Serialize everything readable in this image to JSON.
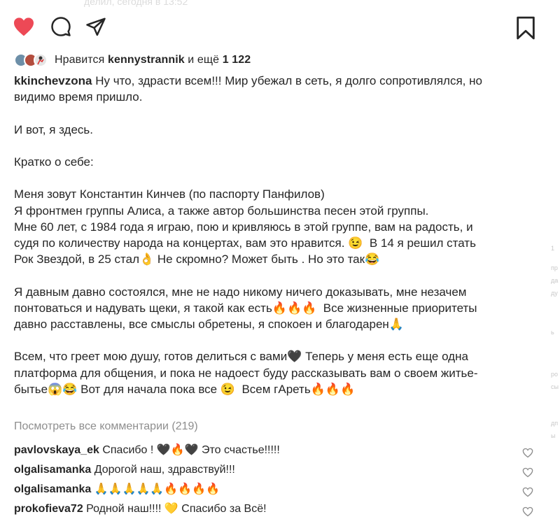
{
  "top_faded_text": "делил, сегодня в 13:52",
  "actions": {
    "like_icon": "heart-filled-icon",
    "comment_icon": "comment-bubble-icon",
    "share_icon": "send-paper-plane-icon",
    "save_icon": "bookmark-icon",
    "like_color": "#ed4956"
  },
  "likes": {
    "prefix": "Нравится",
    "user": "kennystrannik",
    "middle": "и ещё",
    "count": "1 122"
  },
  "caption": {
    "author": "kkinchevzona",
    "text": " Ну что, здрасти всем!!! Мир убежал в сеть, я долго сопротивлялся, но\nвидимо время пришло.\n\nИ вот, я здесь.\n\nКратко о себе:\n\nМеня зовут Константин Кинчев (по паспорту Панфилов)\nЯ фронтмен группы Алиса, а также автор большинства песен этой группы.\nМне 60 лет, с 1984 года я играю, пою и кривляюсь в этой группе, вам на радость, и\nсудя по количеству народа на концертах, вам это нравится. 😉  В 14 я решил стать\nРок Звездой, в 25 стал👌 Не скромно? Может быть . Но это так😂\n\nЯ давным давно состоялся, мне не надо никому ничего доказывать, мне незачем\nпонтоваться и надувать щеки, я такой как есть🔥🔥🔥  Все жизненные приоритеты\nдавно расставлены, все смыслы обретены, я спокоен и благодарен🙏\n\nВсем, что греет мою душу, готов делиться с вами🖤 Теперь у меня есть еще одна\nплатформа для общения, и пока не надоест буду рассказывать вам о своем житье-\nбытье😱😂 Вот для начала пока все 😉  Всем гАреть🔥🔥🔥"
  },
  "view_all_comments": "Посмотреть все комментарии (219)",
  "comments": [
    {
      "user": "pavlovskaya_ek",
      "text": " Спасибо ! 🖤🔥🖤 Это счастье!!!!!"
    },
    {
      "user": "olgalisamanka",
      "text": " Дорогой наш, здравствуй!!!"
    },
    {
      "user": "olgalisamanka",
      "text": " 🙏🙏🙏🙏🙏🔥🔥🔥🔥"
    },
    {
      "user": "prokofieva72",
      "text": " Родной наш!!!! 💛 Спасибо за Всё!"
    }
  ],
  "right_strip": [
    "1",
    "пр",
    "да",
    "ду",
    "ь",
    "ро",
    "сы",
    "дп",
    "ы"
  ]
}
